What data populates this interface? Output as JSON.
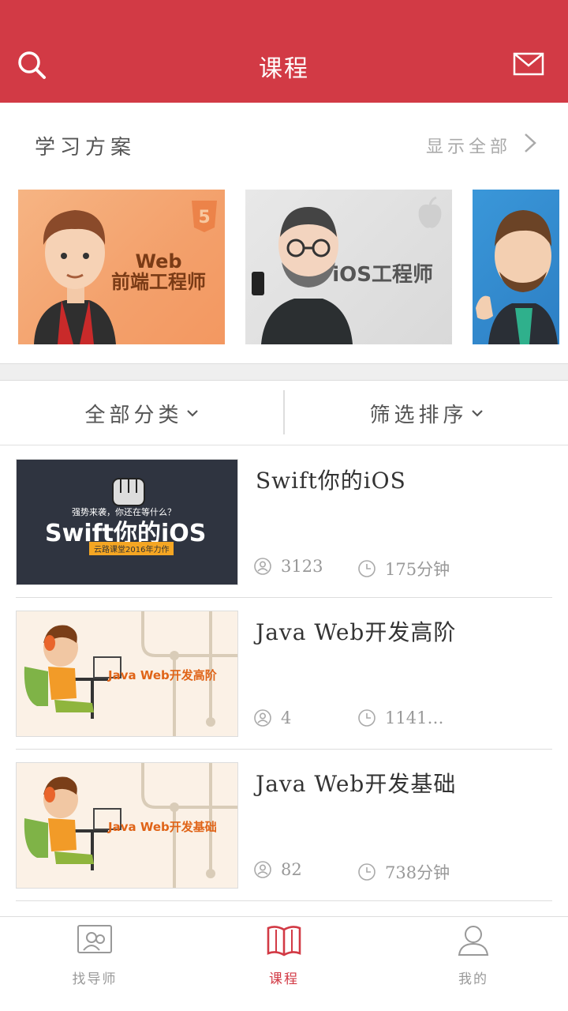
{
  "header": {
    "title": "课程",
    "search_icon": "search-icon",
    "mail_icon": "mail-icon",
    "background": "#d23a45"
  },
  "plans": {
    "section_title": "学习方案",
    "show_all": "显示全部",
    "cards": [
      {
        "label_line1": "Web",
        "label_line2": "前端工程师",
        "badge": "5"
      },
      {
        "label": "iOS工程师"
      },
      {
        "label": ""
      }
    ]
  },
  "filters": {
    "category": "全部分类",
    "sort": "筛选排序"
  },
  "courses": [
    {
      "title": "Swift你的iOS",
      "users": "3123",
      "duration": "175分钟",
      "thumb_text": "Swift你的iOS",
      "thumb_sub": "强势来袭，你还在等什么？",
      "thumb_tag": "云路课堂2016年力作"
    },
    {
      "title": "Java Web开发高阶",
      "users": "4",
      "duration": "1141…",
      "thumb_text": "Java Web开发高阶"
    },
    {
      "title": "Java Web开发基础",
      "users": "82",
      "duration": "738分钟",
      "thumb_text": "Java Web开发基础"
    }
  ],
  "tabbar": {
    "tabs": [
      {
        "label": "找导师",
        "icon": "mentor-icon"
      },
      {
        "label": "课程",
        "icon": "book-icon",
        "active": true
      },
      {
        "label": "我的",
        "icon": "user-icon"
      }
    ],
    "active_color": "#d23a45"
  }
}
